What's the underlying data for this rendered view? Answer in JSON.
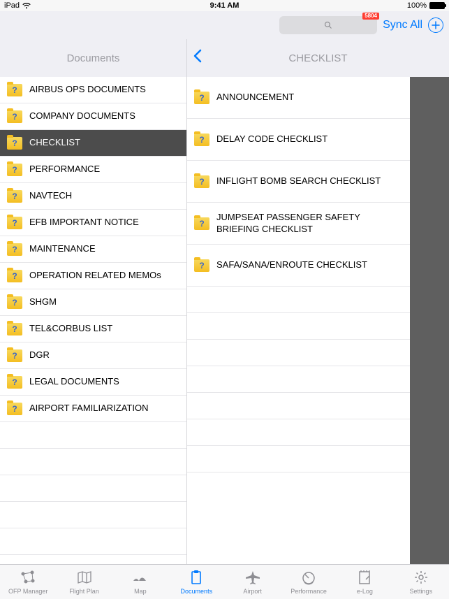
{
  "status": {
    "device": "iPad",
    "time": "9:41 AM",
    "battery": "100%"
  },
  "toolbar": {
    "sync": "Sync All",
    "badge": "5804"
  },
  "headers": {
    "left": "Documents",
    "right": "CHECKLIST"
  },
  "left_items": [
    {
      "label": "AIRBUS OPS DOCUMENTS",
      "selected": false
    },
    {
      "label": "COMPANY DOCUMENTS",
      "selected": false
    },
    {
      "label": "CHECKLIST",
      "selected": true
    },
    {
      "label": "PERFORMANCE",
      "selected": false
    },
    {
      "label": "NAVTECH",
      "selected": false
    },
    {
      "label": "EFB IMPORTANT NOTICE",
      "selected": false
    },
    {
      "label": "MAINTENANCE",
      "selected": false
    },
    {
      "label": "OPERATION RELATED MEMOs",
      "selected": false
    },
    {
      "label": "SHGM",
      "selected": false
    },
    {
      "label": "TEL&CORBUS LIST",
      "selected": false
    },
    {
      "label": "DGR",
      "selected": false
    },
    {
      "label": "LEGAL DOCUMENTS",
      "selected": false
    },
    {
      "label": "AIRPORT FAMILIARIZATION",
      "selected": false
    }
  ],
  "right_items": [
    {
      "label": "ANNOUNCEMENT"
    },
    {
      "label": "DELAY CODE CHECKLIST"
    },
    {
      "label": "INFLIGHT BOMB SEARCH CHECKLIST"
    },
    {
      "label": "JUMPSEAT PASSENGER SAFETY BRIEFING CHECKLIST"
    },
    {
      "label": "SAFA/SANA/ENROUTE CHECKLIST"
    }
  ],
  "tabs": [
    {
      "label": "OFP Manager",
      "icon": "network",
      "active": false
    },
    {
      "label": "Flight Plan",
      "icon": "map-fold",
      "active": false
    },
    {
      "label": "Map",
      "icon": "terrain",
      "active": false
    },
    {
      "label": "Documents",
      "icon": "clipboard",
      "active": true
    },
    {
      "label": "Airport",
      "icon": "plane",
      "active": false
    },
    {
      "label": "Performance",
      "icon": "gauge",
      "active": false
    },
    {
      "label": "e-Log",
      "icon": "notepad",
      "active": false
    },
    {
      "label": "Settings",
      "icon": "gear",
      "active": false
    }
  ]
}
